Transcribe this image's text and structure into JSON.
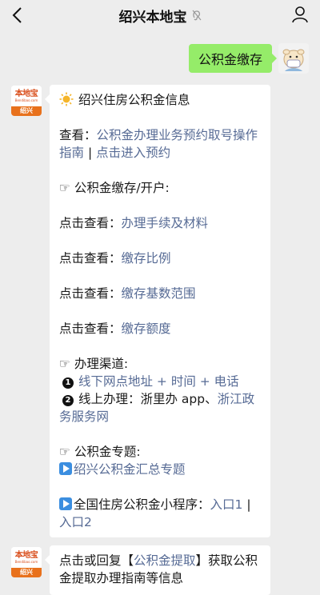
{
  "header": {
    "title": "绍兴本地宝",
    "back_icon": "chevron-left-icon",
    "mute_icon": "ear-icon",
    "contact_icon": "person-icon"
  },
  "bot": {
    "logo_text": "本地宝",
    "logo_sub": "Bendibao.com",
    "logo_city": "绍兴"
  },
  "user_message": "公积金缴存",
  "message1": {
    "title": "绍兴住房公积金信息",
    "view_label": "查看：",
    "view_link1": "公积金办理业务预约取号操作指南",
    "view_sep": " | ",
    "view_link2": "点击进入预约",
    "section1_heading": "☞ 公积金缴存/开户:",
    "click_label": "点击查看：",
    "link_procedures": "办理手续及材料",
    "link_ratio": "缴存比例",
    "link_base": "缴存基数范围",
    "link_amount": "缴存额度",
    "section2_heading": "☞ 办理渠道:",
    "channel1_num": "1",
    "channel1_link": "线下网点地址 + 时间 + 电话",
    "channel2_num": "2",
    "channel2_text": "线上办理：浙里办 app、",
    "channel2_link": "浙江政务服务网",
    "section3_heading": "☞ 公积金专题:",
    "topic_link": "绍兴公积金汇总专题",
    "national_label": "全国住房公积金小程序：",
    "entry1": "入口1",
    "entry_sep": " | ",
    "entry2": "入口2"
  },
  "message2": {
    "prefix": "点击或回复【",
    "link": "公积金提取",
    "suffix": "】获取公积金提取办理指南等信息"
  }
}
